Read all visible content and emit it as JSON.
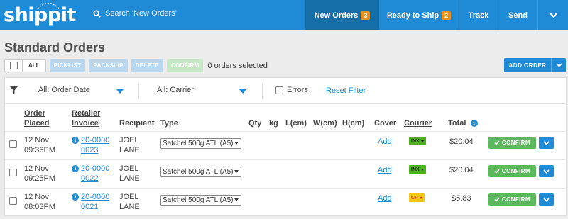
{
  "brand": {
    "logo_text": "shippit"
  },
  "search": {
    "placeholder": "Search 'New Orders'"
  },
  "nav": {
    "new_orders": {
      "label": "New Orders",
      "count": "3"
    },
    "ready_to_ship": {
      "label": "Ready to Ship",
      "count": "2"
    },
    "track": {
      "label": "Track"
    },
    "send": {
      "label": "Send"
    }
  },
  "page": {
    "title": "Standard Orders"
  },
  "toolbar": {
    "all_label": "ALL",
    "picklist": "PICKLIST",
    "packslip": "PACKSLIP",
    "delete": "DELETE",
    "confirm": "CONFIRM",
    "selected_text": "0 orders selected",
    "add_order": "ADD ORDER"
  },
  "filters": {
    "date": "All: Order Date",
    "carrier": "All: Carrier",
    "errors_label": "Errors",
    "reset": "Reset Filter"
  },
  "table": {
    "headers": {
      "order_placed_1": "Order",
      "order_placed_2": "Placed",
      "retailer_invoice_1": "Retailer",
      "retailer_invoice_2": "Invoice",
      "recipient": "Recipient",
      "type": "Type",
      "qty": "Qty",
      "kg": "kg",
      "l": "L(cm)",
      "w": "W(cm)",
      "h": "H(cm)",
      "cover": "Cover",
      "courier": "Courier",
      "total": "Total"
    },
    "rows": [
      {
        "date": "12 Nov",
        "time": "09:36PM",
        "inv1": "20-0000",
        "inv2": "0023",
        "first": "JOEL",
        "last": "LANE",
        "type": "Satchel 500g ATL (A5)",
        "cover": "Add",
        "courier": "INX",
        "total": "$20.04",
        "confirm": "CONFIRM"
      },
      {
        "date": "12 Nov",
        "time": "09:25PM",
        "inv1": "20-0000",
        "inv2": "0022",
        "first": "JOEL",
        "last": "LANE",
        "type": "Satchel 500g ATL (A5)",
        "cover": "Add",
        "courier": "INX",
        "total": "$20.04",
        "confirm": "CONFIRM"
      },
      {
        "date": "12 Nov",
        "time": "08:03PM",
        "inv1": "20-0000",
        "inv2": "0021",
        "first": "JOEL",
        "last": "LANE",
        "type": "Satchel 500g ATL (A5)",
        "cover": "Add",
        "courier": "CP",
        "total": "$5.83",
        "confirm": "CONFIRM"
      }
    ]
  },
  "colors": {
    "brand_blue": "#1f8ad6",
    "nav_active": "#166ea9",
    "badge_orange": "#e8901c",
    "confirm_green": "#5cb85c",
    "courier_inx": "#4caf1e",
    "courier_cp": "#f5c518"
  }
}
